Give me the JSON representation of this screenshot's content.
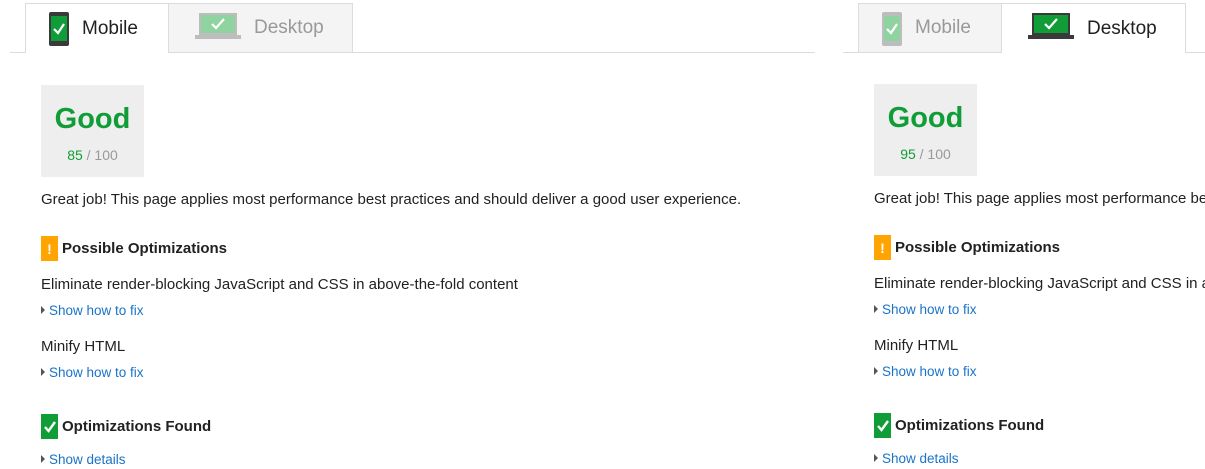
{
  "colors": {
    "good": "#109d38",
    "warning": "#ffa400",
    "link": "#1a73c8"
  },
  "left": {
    "tabs": [
      {
        "label": "Mobile",
        "icon": "mobile-phone-icon",
        "active": true
      },
      {
        "label": "Desktop",
        "icon": "desktop-monitor-icon",
        "active": false
      }
    ],
    "score": {
      "rating": "Good",
      "value": "85",
      "max": "/ 100"
    },
    "summary": "Great job! This page applies most performance best practices and should deliver a good user experience.",
    "possible": {
      "title": "Possible Optimizations",
      "badge": "!",
      "items": [
        {
          "label": "Eliminate render-blocking JavaScript and CSS in above-the-fold content",
          "link": "Show how to fix"
        },
        {
          "label": "Minify HTML",
          "link": "Show how to fix"
        }
      ]
    },
    "found": {
      "title": "Optimizations Found",
      "link": "Show details"
    }
  },
  "right": {
    "tabs": [
      {
        "label": "Mobile",
        "icon": "mobile-phone-icon",
        "active": false
      },
      {
        "label": "Desktop",
        "icon": "desktop-monitor-icon",
        "active": true
      }
    ],
    "score": {
      "rating": "Good",
      "value": "95",
      "max": "/ 100"
    },
    "summary": "Great job! This page applies most performance best practices and should deliver a good user experience.",
    "possible": {
      "title": "Possible Optimizations",
      "badge": "!",
      "items": [
        {
          "label": "Eliminate render-blocking JavaScript and CSS in above-the-fold content",
          "link": "Show how to fix"
        },
        {
          "label": "Minify HTML",
          "link": "Show how to fix"
        }
      ]
    },
    "found": {
      "title": "Optimizations Found",
      "link": "Show details"
    }
  }
}
